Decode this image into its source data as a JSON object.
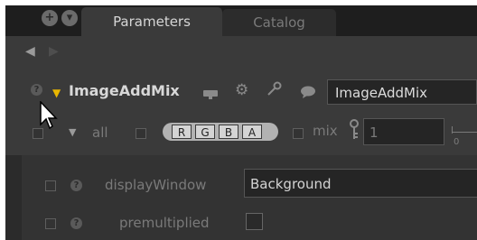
{
  "tabs": [
    {
      "label": "Parameters",
      "active": true
    },
    {
      "label": "Catalog",
      "active": false
    }
  ],
  "tabbar_icons": [
    "plus-icon",
    "chevron-down-icon"
  ],
  "nav": {
    "back_icon": "triangle-left-icon",
    "forward_icon": "triangle-right-icon"
  },
  "node": {
    "title": "ImageAddMix",
    "name_value": "ImageAddMix",
    "header_icons": [
      "viewer-icon",
      "gear-icon",
      "wrench-icon",
      "comment-icon"
    ]
  },
  "channels": {
    "label": "all",
    "buttons": [
      "R",
      "G",
      "B",
      "A"
    ]
  },
  "mix": {
    "label": "mix",
    "value": "1",
    "slider_min_label": "0"
  },
  "params": {
    "display_window_label": "displayWindow",
    "display_window_value": "Background",
    "premultiplied_label": "premultiplied",
    "premultiplied_checked": false
  },
  "colors": {
    "accent_triangle": "#e8b600",
    "panel_bg": "#3a3a3a",
    "tabbar_bg": "#1e1e1e"
  }
}
